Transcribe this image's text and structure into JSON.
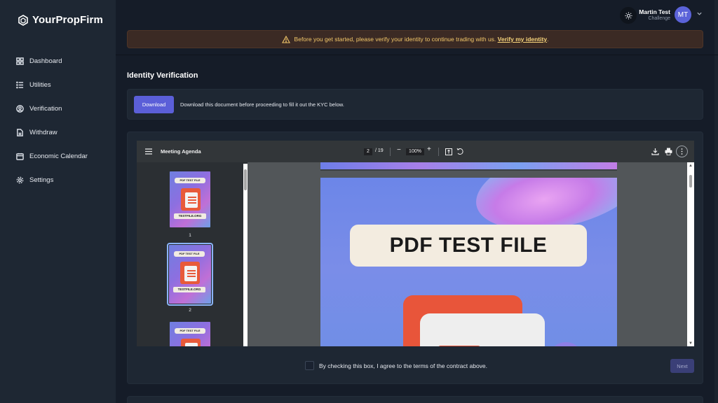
{
  "brand": {
    "name": "YourPropFirm"
  },
  "sidebar": {
    "items": [
      {
        "label": "Dashboard",
        "icon": "grid-icon"
      },
      {
        "label": "Utilities",
        "icon": "list-icon"
      },
      {
        "label": "Verification",
        "icon": "user-circle-icon"
      },
      {
        "label": "Withdraw",
        "icon": "document-icon"
      },
      {
        "label": "Economic Calendar",
        "icon": "calendar-icon"
      },
      {
        "label": "Settings",
        "icon": "gear-icon"
      }
    ]
  },
  "user": {
    "name": "Martin Test",
    "role": "Challenge",
    "initials": "MT"
  },
  "alert": {
    "message": "Before you get started, please verify your identity to continue trading with us.",
    "link": "Verify my identity",
    "suffix": "."
  },
  "page": {
    "title": "Identity Verification"
  },
  "download": {
    "button": "Download",
    "text": "Download this document before proceeding to fill it out the KYC below."
  },
  "pdf_viewer": {
    "title": "Meeting Agenda",
    "current_page": "2",
    "total_pages": "/ 19",
    "zoom": "100%",
    "thumbnails": [
      {
        "num": "1",
        "label": "PDF TEST FILE",
        "site": "TESTFILE.ORG"
      },
      {
        "num": "2",
        "label": "PDF TEST FILE",
        "site": "TESTFILE.ORG"
      },
      {
        "label": "PDF TEST FILE"
      }
    ],
    "page_heading": "PDF TEST FILE"
  },
  "agreement": {
    "text": "By checking this box, I agree to the terms of the contract above."
  },
  "next_button": "Next",
  "colors": {
    "accent": "#5b5fd8",
    "alert_bg": "#3b2a24",
    "alert_text": "#f2c76a",
    "background": "#151c28",
    "panel": "#1e2733"
  }
}
